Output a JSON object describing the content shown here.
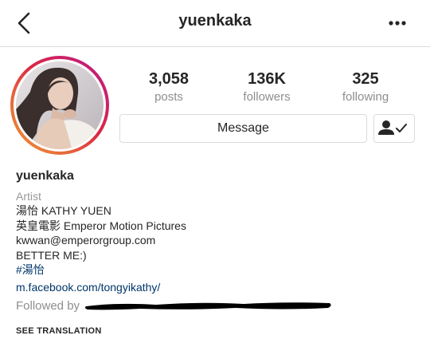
{
  "header": {
    "title": "yuenkaka",
    "back_icon": "chevron-left-icon",
    "more_icon": "more-options-icon"
  },
  "stats": [
    {
      "value": "3,058",
      "label": "posts"
    },
    {
      "value": "136K",
      "label": "followers"
    },
    {
      "value": "325",
      "label": "following"
    }
  ],
  "actions": {
    "message_label": "Message",
    "following_icon": "person-check-icon"
  },
  "bio": {
    "name": "yuenkaka",
    "category": "Artist",
    "lines": [
      "湯怡 KATHY YUEN",
      "英皇電影 Emperor Motion Pictures",
      "kwwan@emperorgroup.com",
      "BETTER ME:)"
    ],
    "hashtag": "#湯怡",
    "link": "m.facebook.com/tongyikathy/"
  },
  "followed_by": {
    "prefix": "Followed by"
  },
  "see_translation": "SEE TRANSLATION",
  "colors": {
    "link": "#003569",
    "muted": "#8e8e8e",
    "border": "#dbdbdb",
    "text": "#262626"
  }
}
